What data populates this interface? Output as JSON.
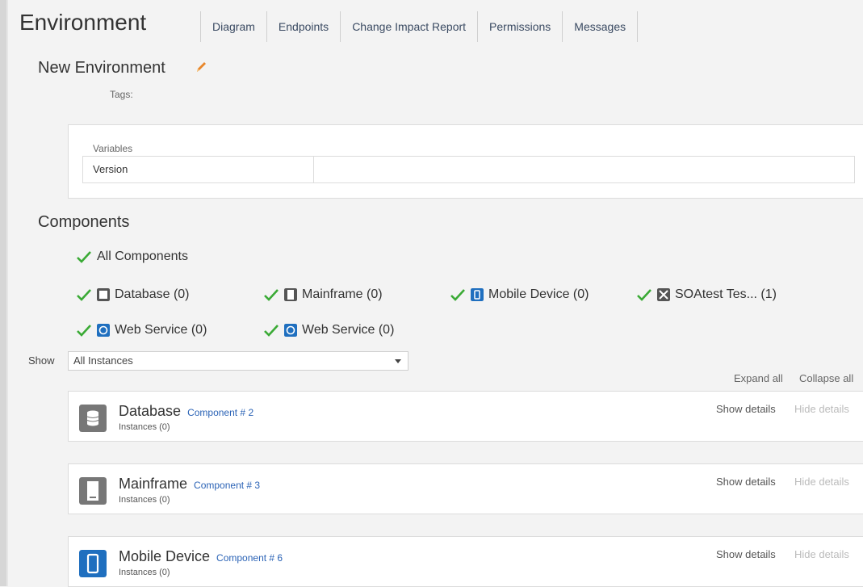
{
  "header": {
    "title": "Environment",
    "tabs": [
      "Diagram",
      "Endpoints",
      "Change Impact Report",
      "Permissions",
      "Messages"
    ]
  },
  "environment": {
    "name": "New Environment",
    "tags_label": "Tags:"
  },
  "variables": {
    "label": "Variables",
    "rows": [
      {
        "name": "Version",
        "value": ""
      }
    ]
  },
  "components": {
    "title": "Components",
    "all_label": "All Components",
    "filters": [
      {
        "label": "Database (0)",
        "icon": "database-icon"
      },
      {
        "label": "Mainframe (0)",
        "icon": "mainframe-icon"
      },
      {
        "label": "Mobile Device (0)",
        "icon": "mobile-device-icon"
      },
      {
        "label": "SOAtest Tes...  (1)",
        "icon": "soatest-icon"
      },
      {
        "label": "Web Service (0)",
        "icon": "web-service-icon"
      },
      {
        "label": "Web Service (0)",
        "icon": "web-service-icon"
      }
    ],
    "show_label": "Show",
    "show_value": "All Instances",
    "expand_all": "Expand all",
    "collapse_all": "Collapse all",
    "show_details": "Show details",
    "hide_details": "Hide details",
    "cards": [
      {
        "name": "Database",
        "link": "Component # 2",
        "instances": "Instances (0)",
        "icon": "database-icon"
      },
      {
        "name": "Mainframe",
        "link": "Component # 3",
        "instances": "Instances (0)",
        "icon": "mainframe-icon"
      },
      {
        "name": "Mobile Device",
        "link": "Component # 6",
        "instances": "Instances (0)",
        "icon": "mobile-device-icon"
      }
    ]
  },
  "colors": {
    "check": "#3aaa35",
    "link": "#2b63b6",
    "pencil": "#e8862a",
    "icon_gray": "#555555",
    "icon_blue": "#1f6fbf"
  }
}
